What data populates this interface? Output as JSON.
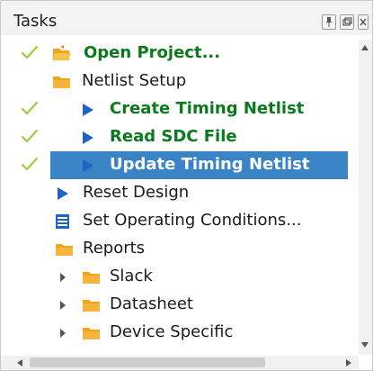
{
  "panel": {
    "title": "Tasks",
    "buttons": [
      "pin",
      "restore",
      "close"
    ]
  },
  "tasks": [
    {
      "label": "Open Project...",
      "completed": true,
      "style": "green-bold",
      "icon": "open-folder-icon"
    },
    {
      "label": "Netlist Setup",
      "completed": false,
      "style": "normal",
      "icon": "folder-icon"
    },
    {
      "label": "Create Timing Netlist",
      "completed": true,
      "style": "green-bold",
      "icon": "play-icon"
    },
    {
      "label": "Read SDC File",
      "completed": true,
      "style": "green-bold",
      "icon": "play-icon"
    },
    {
      "label": "Update Timing Netlist",
      "completed": true,
      "style": "selected",
      "icon": "play-icon"
    },
    {
      "label": "Reset Design",
      "completed": false,
      "style": "normal",
      "icon": "play-icon"
    },
    {
      "label": "Set Operating Conditions...",
      "completed": false,
      "style": "normal",
      "icon": "list-icon"
    },
    {
      "label": "Reports",
      "completed": false,
      "style": "normal",
      "icon": "folder-icon"
    },
    {
      "label": "Slack",
      "completed": false,
      "style": "normal",
      "icon": "folder-icon",
      "expandable": true
    },
    {
      "label": "Datasheet",
      "completed": false,
      "style": "normal",
      "icon": "folder-icon",
      "expandable": true
    },
    {
      "label": "Device Specific",
      "completed": false,
      "style": "normal",
      "icon": "folder-icon",
      "expandable": true
    }
  ],
  "colors": {
    "completed_text": "#0a7a1e",
    "check": "#9ccc3a",
    "selection": "#3a84c6",
    "play": "#1f63c6",
    "folder": "#f2a51a"
  }
}
